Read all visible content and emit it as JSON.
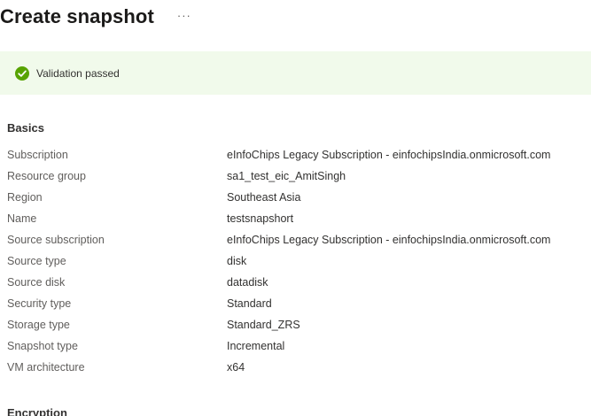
{
  "header": {
    "title": "Create snapshot",
    "more_label": "···"
  },
  "validation": {
    "icon": "check-circle-icon",
    "status_color": "#57a300",
    "background": "#f1faeb",
    "text": "Validation passed"
  },
  "basics": {
    "heading": "Basics",
    "rows": [
      {
        "label": "Subscription",
        "value": "eInfoChips Legacy Subscription - einfochipsIndia.onmicrosoft.com"
      },
      {
        "label": "Resource group",
        "value": "sa1_test_eic_AmitSingh"
      },
      {
        "label": "Region",
        "value": "Southeast Asia"
      },
      {
        "label": "Name",
        "value": "testsnapshort"
      },
      {
        "label": "Source subscription",
        "value": "eInfoChips Legacy Subscription - einfochipsIndia.onmicrosoft.com"
      },
      {
        "label": "Source type",
        "value": "disk"
      },
      {
        "label": "Source disk",
        "value": "datadisk"
      },
      {
        "label": "Security type",
        "value": "Standard"
      },
      {
        "label": "Storage type",
        "value": "Standard_ZRS"
      },
      {
        "label": "Snapshot type",
        "value": "Incremental"
      },
      {
        "label": "VM architecture",
        "value": "x64"
      }
    ]
  },
  "encryption": {
    "heading": "Encryption"
  }
}
